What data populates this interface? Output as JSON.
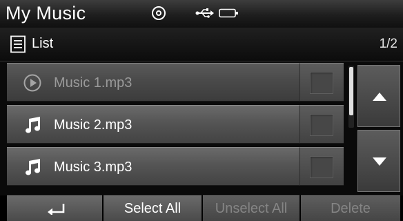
{
  "header": {
    "title": "My Music",
    "icons": [
      "disc-icon",
      "usb-icon",
      "battery-icon"
    ]
  },
  "listbar": {
    "icon": "list-icon",
    "label": "List",
    "page_indicator": "1/2"
  },
  "rows": [
    {
      "label": "Music 1.mp3",
      "icon": "play-icon",
      "state": "playing",
      "enabled": false,
      "checked": false
    },
    {
      "label": "Music 2.mp3",
      "icon": "music-note-icon",
      "enabled": true,
      "checked": false
    },
    {
      "label": "Music 3.mp3",
      "icon": "music-note-icon",
      "enabled": true,
      "checked": false
    }
  ],
  "scroll": {
    "up_icon": "arrow-up-icon",
    "down_icon": "arrow-down-icon",
    "position": 0.0
  },
  "bottombar": {
    "back_icon": "back-arrow-icon",
    "select_all": "Select All",
    "unselect_all": "Unselect All",
    "delete": "Delete",
    "unselect_all_enabled": false,
    "delete_enabled": false
  },
  "colors": {
    "background": "#0a0a0a",
    "text": "#ffffff",
    "disabled_text": "#9a9a9a",
    "row": "#555555"
  }
}
